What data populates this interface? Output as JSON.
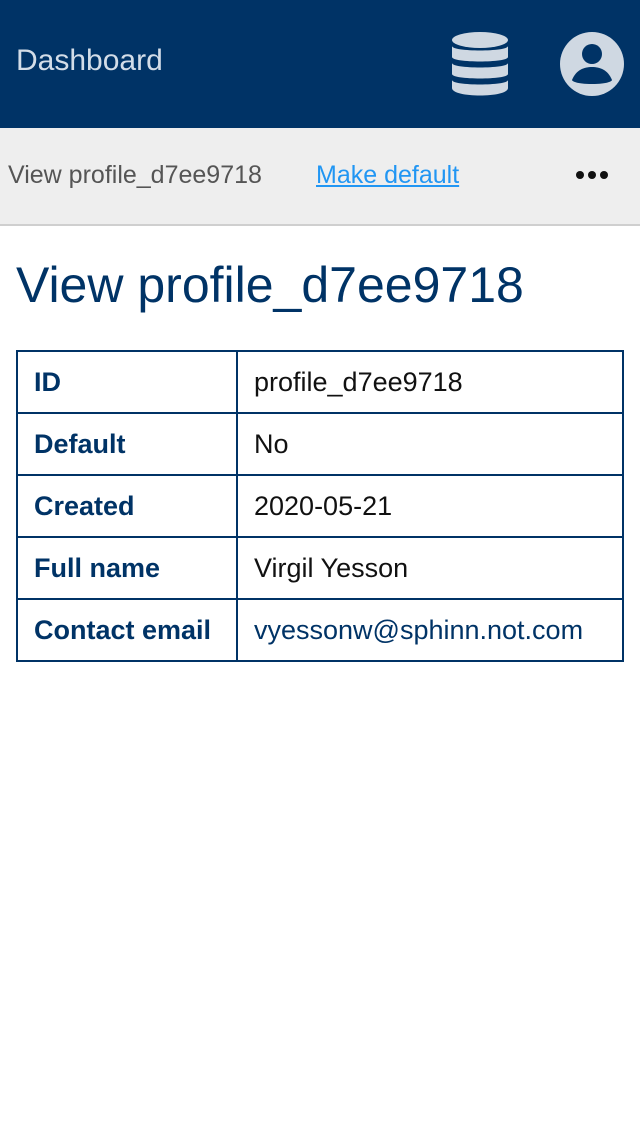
{
  "header": {
    "app_title": "Dashboard",
    "icons": [
      "database-icon",
      "user-account-icon"
    ],
    "background_color": "#003366"
  },
  "subbar": {
    "title": "View profile_d7ee9718",
    "make_default_label": "Make default",
    "more_icon": "more-horizontal-icon",
    "link_color": "#2196f3"
  },
  "main": {
    "page_title": "View profile_d7ee9718",
    "details": [
      {
        "label": "ID",
        "value": "profile_d7ee9718"
      },
      {
        "label": "Default",
        "value": "No"
      },
      {
        "label": "Created",
        "value": "2020-05-21"
      },
      {
        "label": "Full name",
        "value": "Virgil Yesson"
      },
      {
        "label": "Contact email",
        "value": "vyessonw@sphinn.not.com"
      }
    ]
  }
}
